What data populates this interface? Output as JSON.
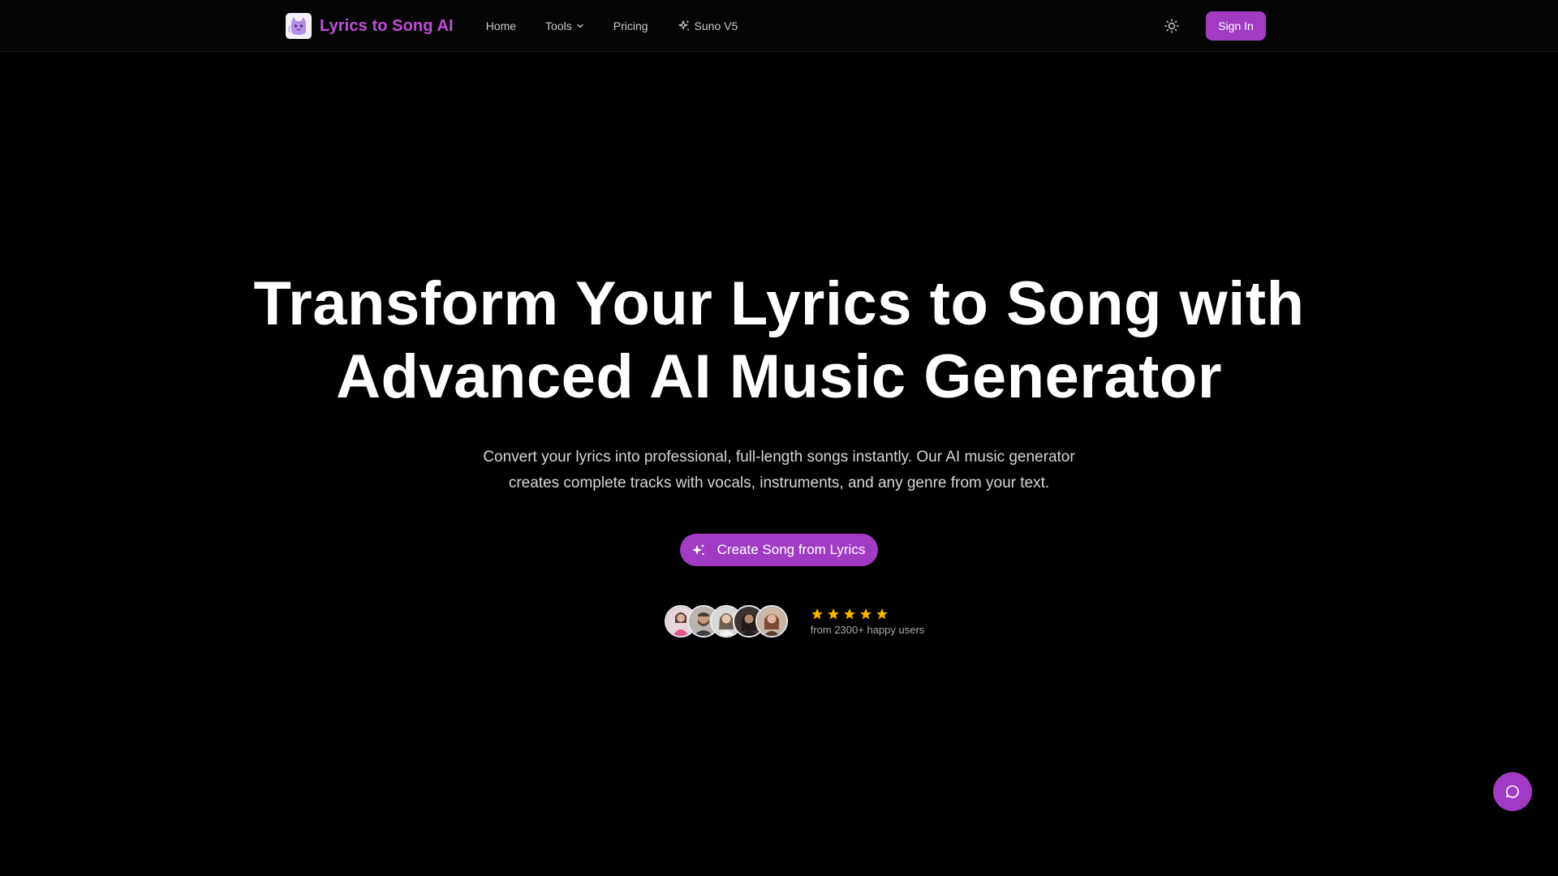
{
  "brand": {
    "name": "Lyrics to Song AI",
    "logo_icon": "cat-logo-icon",
    "color": "#c04fd6"
  },
  "nav": {
    "home": "Home",
    "tools": "Tools",
    "pricing": "Pricing",
    "suno": "Suno V5"
  },
  "header": {
    "theme_icon": "sun-icon",
    "signin_label": "Sign In"
  },
  "hero": {
    "title_line1": "Transform Your Lyrics to Song with",
    "title_line2": "Advanced AI Music Generator",
    "subtitle": "Convert your lyrics into professional, full-length songs instantly. Our AI music generator creates complete tracks with vocals, instruments, and any genre from your text.",
    "cta_label": "Create Song from Lyrics",
    "cta_icon": "sparkles-icon"
  },
  "social_proof": {
    "rating_stars": 5,
    "text": "from 2300+ happy users"
  },
  "chat": {
    "icon": "chat-bubble-icon"
  },
  "colors": {
    "accent": "#a13bc4",
    "background": "#000000",
    "star": "#f5b800"
  }
}
